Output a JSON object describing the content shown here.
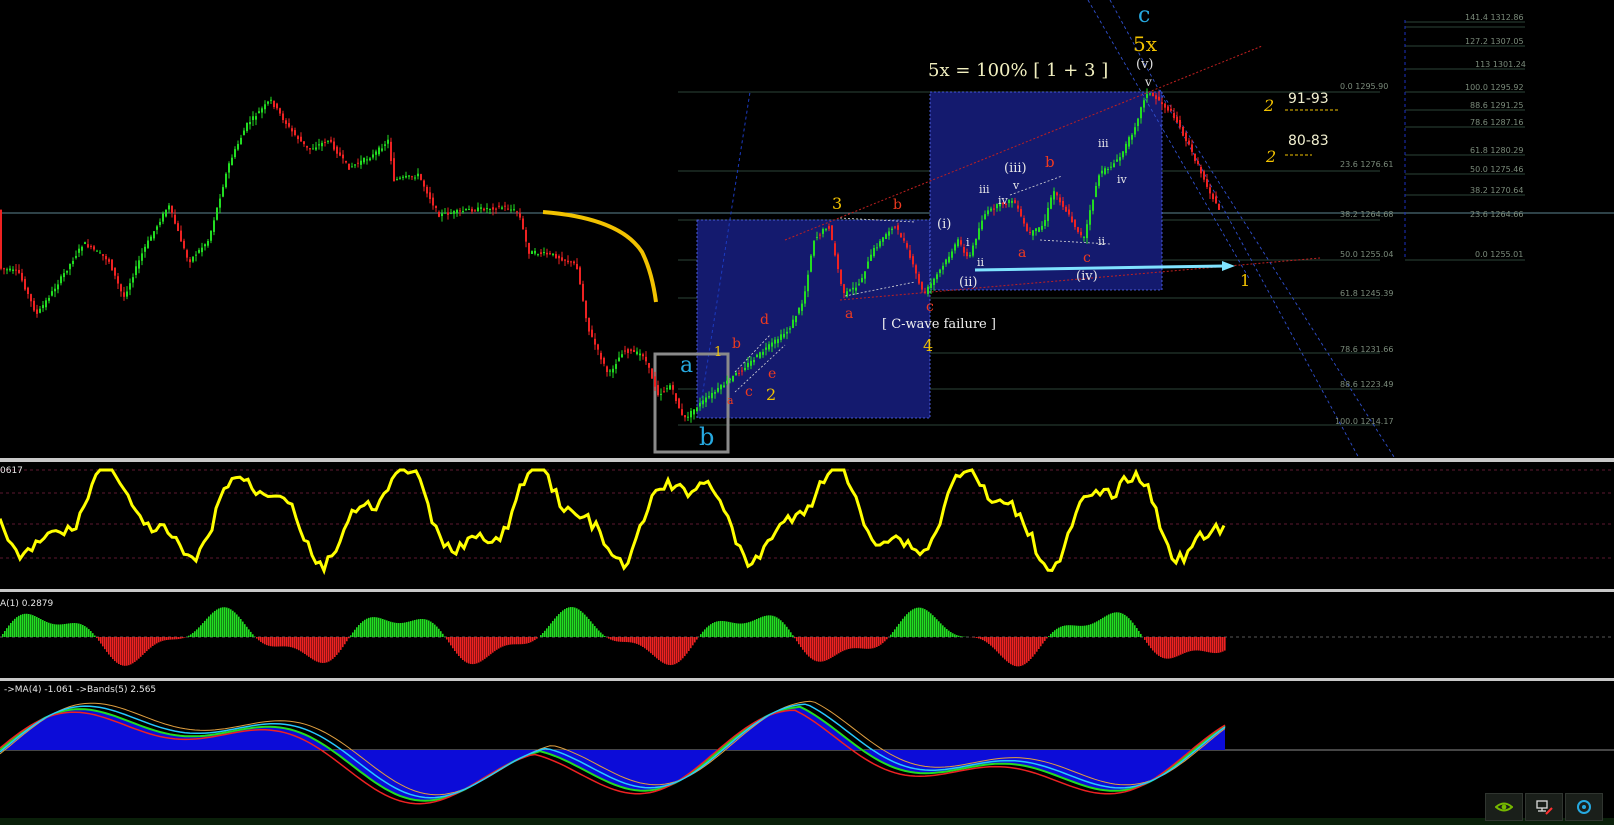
{
  "panels": {
    "osc1_label": "0617",
    "osc2_label": "A(1) 0.2879",
    "osc3_label": "->MA(4) -1.061 ->Bands(5) 2.565"
  },
  "fib_left": [
    "23.6 1276.61",
    "38.2 1264.68",
    "50.0 1255.04",
    "61.8 1245.39",
    "78.6 1231.66",
    "88.6 1223.49",
    "100.0 1214.17"
  ],
  "fib_top": "0.0 1295.90",
  "fib_right": [
    "141.4 1312.86",
    "127.2 1307.05",
    "113 1301.24",
    "100.0 1295.92",
    "88.6 1291.25",
    "78.6 1287.16",
    "61.8 1280.29",
    "50.0 1275.46",
    "38.2 1270.64",
    "23.6 1264.66",
    "0.0 1255.01"
  ],
  "annotations": {
    "headline": "5x = 100% [ 1 + 3 ]",
    "c_top": "c",
    "fivex": "5x",
    "v_paren": "(v)",
    "v_small": "v",
    "a_blue": "a",
    "b_blue": "b",
    "three_yellow": "3",
    "four_yellow": "4",
    "two_yellow": "2",
    "one_yellow_small": "1",
    "one_yellow_right": "1",
    "two_a": "2",
    "two_b": "2",
    "target_1": "91-93",
    "target_2": "80-83",
    "c_wave": "[ C-wave failure ]",
    "red_b1": "b",
    "red_d": "d",
    "red_c1": "c",
    "red_e": "e",
    "red_a1": "a",
    "red_b2": "b",
    "red_c2": "c",
    "red_b3": "b",
    "red_a2": "a",
    "red_c3": "c",
    "red_small_a": "a",
    "w_i": "(i)",
    "w_ii": "(ii)",
    "w_iii": "(iii)",
    "w_iv": "(iv)",
    "w_i_small": "i",
    "w_ii_small": "ii",
    "w_iii_small": "iii",
    "w_iv_small": "iv",
    "w_v_small": "v",
    "w_iii2": "iii",
    "w_iv2": "iv",
    "w_ii2": "ii"
  },
  "colors": {
    "up": "#22dd22",
    "down": "#ee2222",
    "box": "#141a6e",
    "osc": "#ffff00",
    "accent_yellow": "#f2c200",
    "blue_label": "#26a9e0",
    "arrow": "#7fe3ff"
  },
  "tray": [
    {
      "icon": "nvidia-icon"
    },
    {
      "icon": "network-icon"
    },
    {
      "icon": "settings-icon"
    }
  ]
}
